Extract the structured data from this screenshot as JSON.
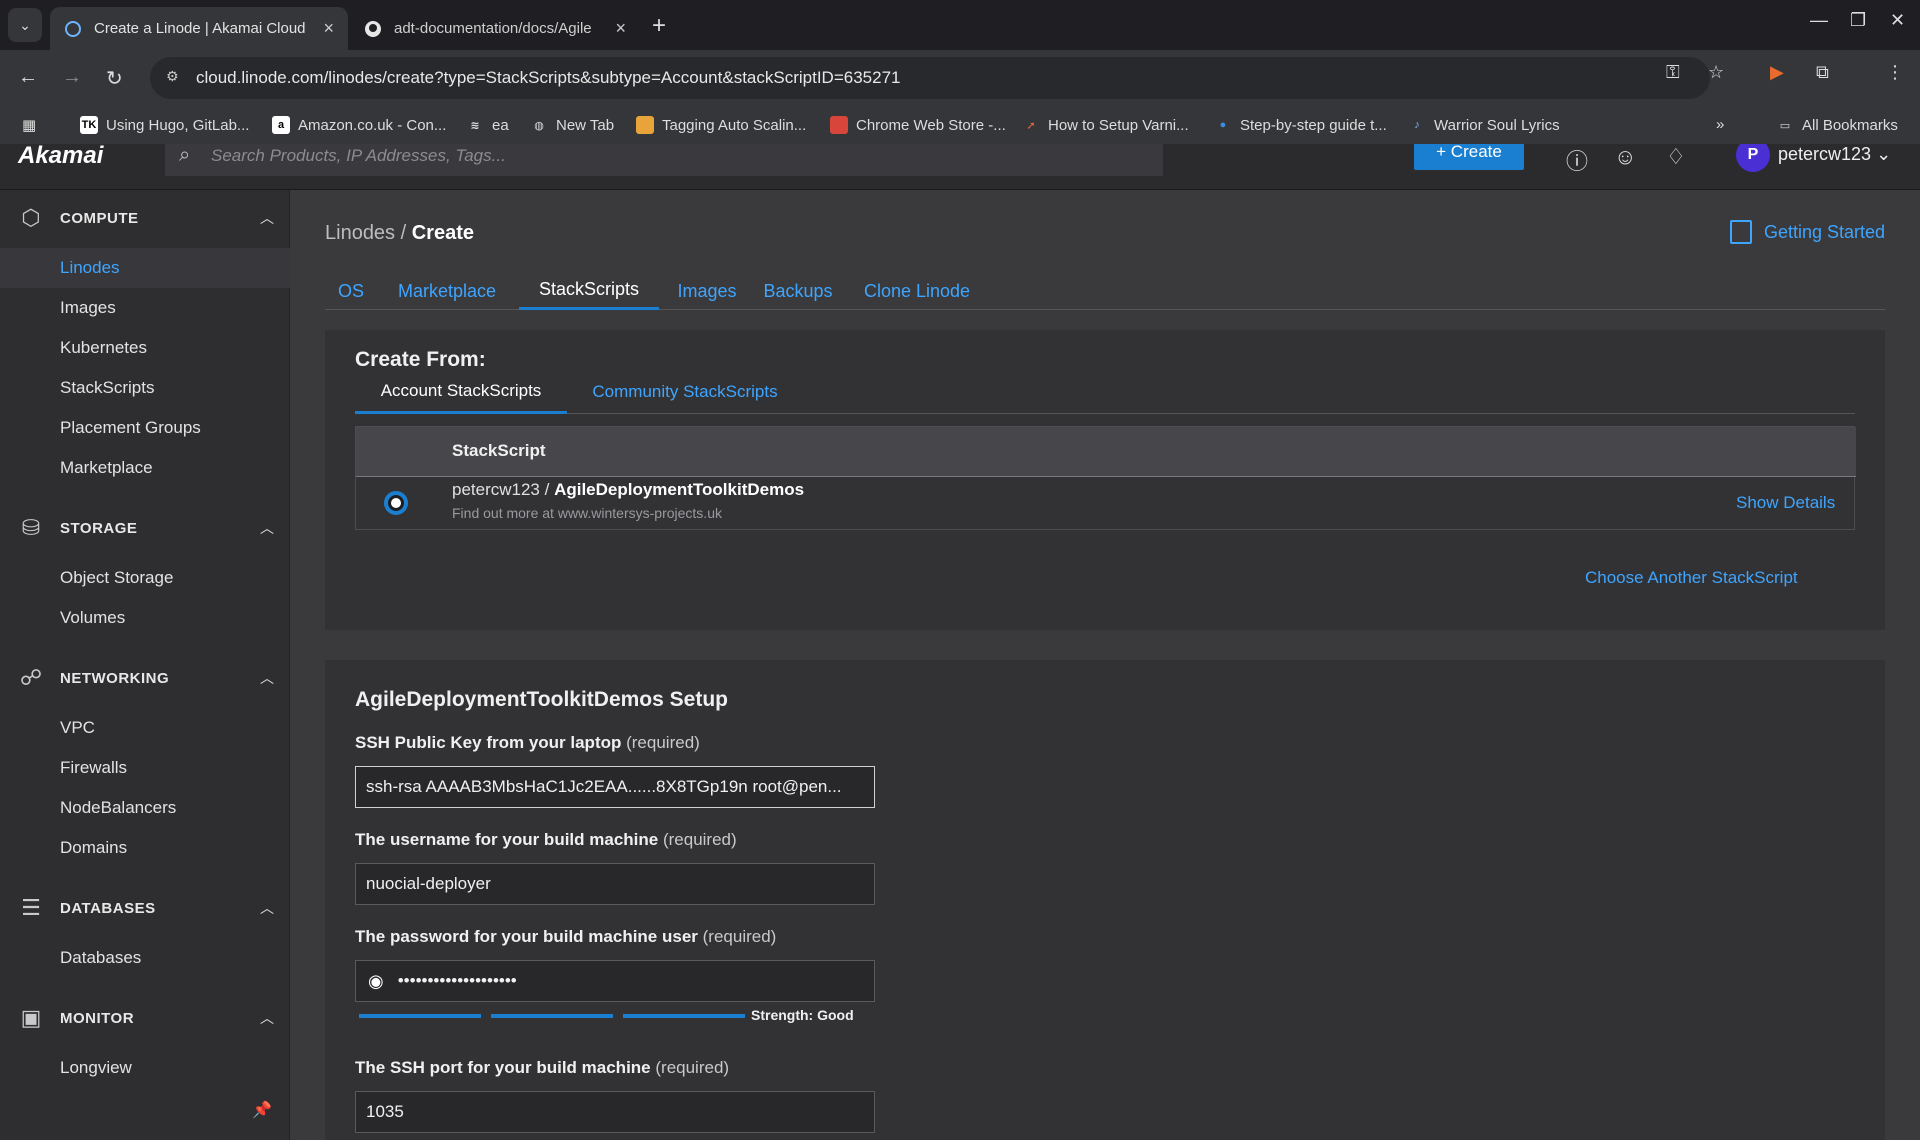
{
  "browser": {
    "tabs": [
      {
        "title": "Create a Linode | Akamai Cloud",
        "close": "×"
      },
      {
        "title": "adt-documentation/docs/Agile",
        "close": "×"
      }
    ],
    "new_tab": "+",
    "url": "cloud.linode.com/linodes/create?type=StackScripts&subtype=Account&stackScriptID=635271",
    "bookmarks": [
      {
        "label": "Using Hugo, GitLab...",
        "icon": "TK"
      },
      {
        "label": "Amazon.co.uk - Con...",
        "icon": "a"
      },
      {
        "label": "ea",
        "icon": ""
      },
      {
        "label": "New Tab",
        "icon": ""
      },
      {
        "label": "Tagging Auto Scalin...",
        "icon": ""
      },
      {
        "label": "Chrome Web Store -...",
        "icon": ""
      },
      {
        "label": "How to Setup Varni...",
        "icon": ""
      },
      {
        "label": "Step-by-step guide t...",
        "icon": ""
      },
      {
        "label": "Warrior Soul Lyrics",
        "icon": ""
      }
    ],
    "all_bookmarks": "All Bookmarks"
  },
  "header": {
    "logo": "Akamai",
    "search_placeholder": "Search Products, IP Addresses, Tags...",
    "create_label": "+ Create",
    "avatar_letter": "P",
    "username": "petercw123"
  },
  "sidebar": {
    "sections": [
      {
        "title": "COMPUTE",
        "items": [
          "Linodes",
          "Images",
          "Kubernetes",
          "StackScripts",
          "Placement Groups",
          "Marketplace"
        ]
      },
      {
        "title": "STORAGE",
        "items": [
          "Object Storage",
          "Volumes"
        ]
      },
      {
        "title": "NETWORKING",
        "items": [
          "VPC",
          "Firewalls",
          "NodeBalancers",
          "Domains"
        ]
      },
      {
        "title": "DATABASES",
        "items": [
          "Databases"
        ]
      },
      {
        "title": "MONITOR",
        "items": [
          "Longview"
        ]
      }
    ],
    "active_item": "Linodes"
  },
  "main": {
    "breadcrumb_parent": "Linodes",
    "breadcrumb_sep": " / ",
    "breadcrumb_current": "Create",
    "getting_started": "Getting Started",
    "tabs": [
      "OS",
      "Marketplace",
      "StackScripts",
      "Images",
      "Backups",
      "Clone Linode"
    ],
    "active_tab": "StackScripts",
    "create_from": {
      "title": "Create From:",
      "subtabs": [
        "Account StackScripts",
        "Community StackScripts"
      ],
      "table_header": "StackScript",
      "row": {
        "owner": "petercw123 / ",
        "name": "AgileDeploymentToolkitDemos",
        "description": "Find out more at www.wintersys-projects.uk",
        "show_details": "Show Details"
      },
      "choose_another": "Choose Another StackScript"
    },
    "setup": {
      "title": "AgileDeploymentToolkitDemos Setup",
      "required": "(required)",
      "fields": [
        {
          "label": "SSH Public Key from your laptop",
          "value": "ssh-rsa AAAAB3MbsHaC1Jc2EAA......8X8TGp19n root@pen..."
        },
        {
          "label": "The username for your build machine",
          "value": "nuocial-deployer"
        },
        {
          "label": "The password for your build machine user",
          "value": "••••••••••••••••••••"
        },
        {
          "label": "The SSH port for your build machine",
          "value": "1035"
        }
      ],
      "strength_label": "Strength: Good",
      "strength_level": 3,
      "strength_max": 3
    }
  },
  "colors": {
    "accent": "#1a7fd0",
    "link": "#3ea5ff",
    "bg": "#3a3a3d",
    "panel": "#323235"
  }
}
